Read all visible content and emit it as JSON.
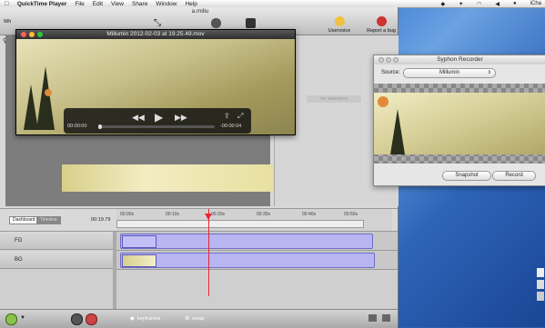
{
  "menubar": {
    "apple": "",
    "app_name": "QuickTime Player",
    "items": [
      "File",
      "Edit",
      "View",
      "Share",
      "Window",
      "Help"
    ],
    "clock": "iCha"
  },
  "main_window": {
    "title": "a.millu",
    "toolbar_left_label": "Wh",
    "tools": [
      {
        "label": "",
        "icon": "resize-arrows-icon"
      },
      {
        "label": "",
        "icon": "camera-icon"
      },
      {
        "label": "",
        "icon": "screen-icon"
      },
      {
        "label": "Uservoice",
        "icon": "lightbulb-icon"
      },
      {
        "label": "Report a bug",
        "icon": "bug-icon"
      }
    ],
    "search_glyph": "🔍",
    "no_selection": "no selection"
  },
  "quicktime": {
    "title": "Millumin 2012-02-03 at 19.25.49.mov",
    "time_elapsed": "00:00:00",
    "time_remaining": "-00:00:04",
    "colors": {
      "close": "#ff5f57",
      "min": "#febc2e",
      "max": "#28c840"
    }
  },
  "syphon": {
    "title": "Syphon Recorder",
    "source_label": "Source:",
    "source_value": "Millumin",
    "snapshot_label": "Snapshot",
    "record_label": "Record"
  },
  "timeline": {
    "tabs": [
      "Dashboard",
      "Timeline"
    ],
    "current_time": "00:19.79",
    "ticks": [
      "00:00s",
      "00:10s",
      "00:20s",
      "00:30s",
      "00:40s",
      "00:50s"
    ],
    "rows": [
      "FG",
      "BG"
    ]
  },
  "bottombar": {
    "keyframes_label": "keyframes",
    "setup_label": "setup"
  }
}
